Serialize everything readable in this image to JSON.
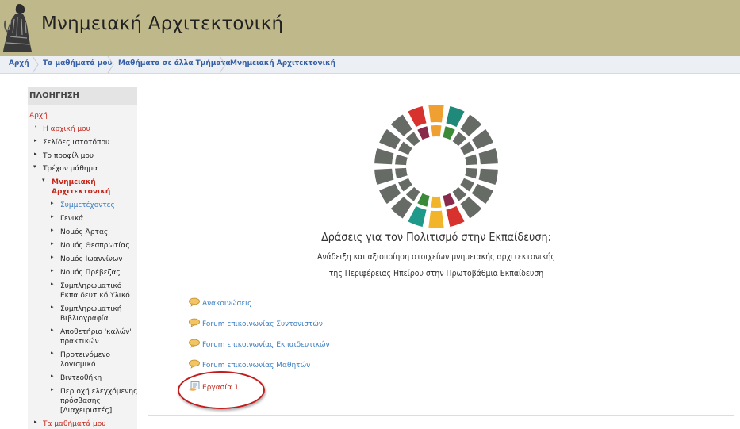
{
  "site": {
    "title": "Μνημειακή Αρχιτεκτονική"
  },
  "breadcrumb": [
    "Αρχή",
    "Τα μαθήματά μου",
    "Μαθήματα σε άλλα Τμήματα",
    "Μνημειακή Αρχιτεκτονική"
  ],
  "navigation": {
    "title": "ΠΛΟΗΓΗΣΗ",
    "home": "Αρχή",
    "dashboard": "Η αρχική μου",
    "site_pages": "Σελίδες ιστοτόπου",
    "profile": "Το προφίλ μου",
    "current_course": "Τρέχον μάθημα",
    "course_line1": "Μνημειακή",
    "course_line2": "Αρχιτεκτονική",
    "participants": "Συμμετέχοντες",
    "sections": [
      {
        "lines": [
          "Γενικά"
        ]
      },
      {
        "lines": [
          "Νομός Άρτας"
        ]
      },
      {
        "lines": [
          "Νομός Θεσπρωτίας"
        ]
      },
      {
        "lines": [
          "Νομός Ιωαννίνων"
        ]
      },
      {
        "lines": [
          "Νομός Πρέβεζας"
        ]
      },
      {
        "lines": [
          "Συμπληρωματικό",
          "Εκπαιδευτικό Υλικό"
        ]
      },
      {
        "lines": [
          "Συμπληρωματική",
          "Βιβλιογραφία"
        ]
      },
      {
        "lines": [
          "Αποθετήριο 'καλών'",
          "πρακτικών"
        ]
      },
      {
        "lines": [
          "Προτεινόμενο",
          "λογισμικό"
        ]
      },
      {
        "lines": [
          "Βιντεοθήκη"
        ]
      },
      {
        "lines": [
          "Περιοχή ελεγχόμενης",
          "πρόσβασης",
          "[Διαχειριστές]"
        ]
      }
    ],
    "my_courses": "Τα μαθήματά μου"
  },
  "banner": {
    "title": "Δράσεις για τον Πολιτισμό στην Εκπαίδευση:",
    "line1": "Ανάδειξη και αξιοποίηση στοιχείων μνημειακής αρχιτεκτονικής",
    "line2": "της Περιφέρειας Ηπείρου στην Πρωτοβάθμια Εκπαίδευση"
  },
  "activities": [
    {
      "label": "Ανακοινώσεις",
      "icon": "forum-icon"
    },
    {
      "label": "Forum επικοινωνίας Συντονιστών",
      "icon": "forum-icon"
    },
    {
      "label": "Forum επικοινωνίας Εκπαιδευτικών",
      "icon": "forum-icon"
    },
    {
      "label": "Forum επικοινωνίας Μαθητών",
      "icon": "forum-icon"
    },
    {
      "label": "Εργασία 1",
      "icon": "assignment-icon"
    }
  ],
  "colors": {
    "header_bg": "#bfb88a",
    "link_blue": "#3b7ec2",
    "active_red": "#c4281c",
    "highlight": "#c21c1c"
  }
}
